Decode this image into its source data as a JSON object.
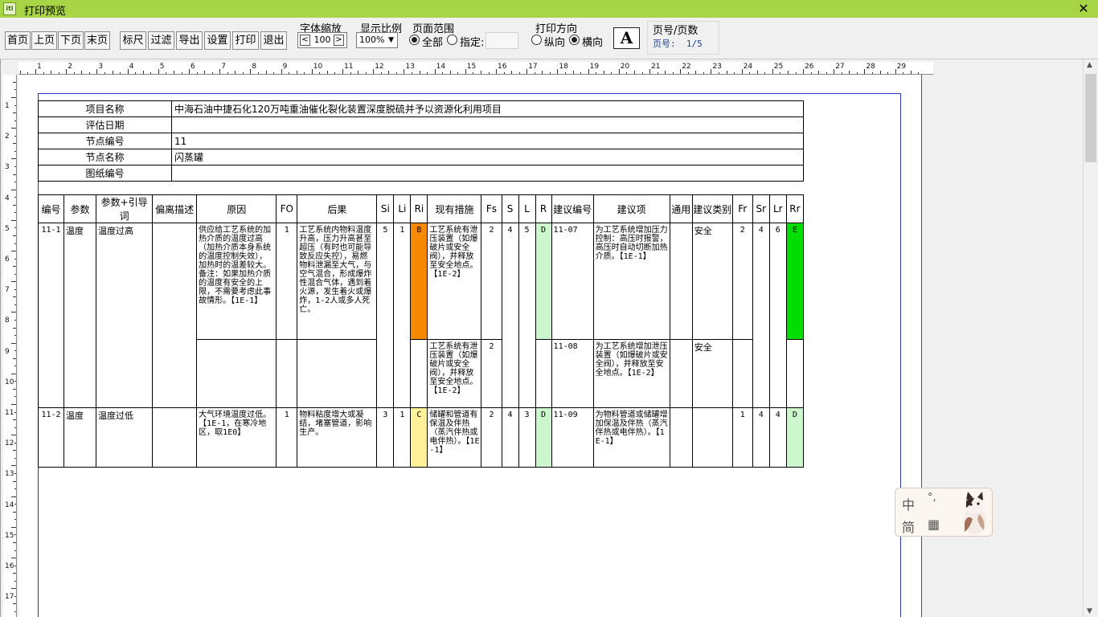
{
  "window": {
    "title": "打印预览",
    "icon_text": "iti",
    "close_label": "✕"
  },
  "toolbar": {
    "first_page": "首页",
    "prev_page": "上页",
    "next_page": "下页",
    "last_page": "末页",
    "ruler": "标尺",
    "filter": "过滤",
    "export": "导出",
    "settings": "设置",
    "print": "打印",
    "exit": "退出",
    "font_zoom_label": "字体缩放",
    "font_zoom_value": "100",
    "display_ratio_label": "显示比例",
    "display_ratio_value": "100%",
    "page_range_label": "页面范围",
    "range_all": "全部",
    "range_specify": "指定:",
    "range_selected": "all",
    "orientation_label": "打印方向",
    "portrait": "纵向",
    "landscape": "横向",
    "orientation_selected": "landscape",
    "font_button": "A",
    "page_count_label": "页号/页数",
    "page_number_text": "页号:  1/5"
  },
  "ruler": {
    "horizontal": [
      "1",
      "2",
      "3",
      "4",
      "5",
      "6",
      "7",
      "8",
      "9",
      "10",
      "11",
      "12",
      "13",
      "14",
      "15",
      "16",
      "17",
      "18",
      "19",
      "20",
      "21",
      "22",
      "23",
      "24",
      "25",
      "26",
      "27",
      "28",
      "29"
    ],
    "vertical": [
      "1",
      "2",
      "3",
      "4",
      "5",
      "6",
      "7",
      "8",
      "9",
      "10",
      "11",
      "12",
      "13",
      "14",
      "15",
      "16",
      "17"
    ]
  },
  "info": [
    {
      "label": "项目名称",
      "value": "中海石油中捷石化120万吨重油催化裂化装置深度脱硫并予以资源化利用项目"
    },
    {
      "label": "评估日期",
      "value": ""
    },
    {
      "label": "节点编号",
      "value": "11"
    },
    {
      "label": "节点名称",
      "value": "闪蒸罐"
    },
    {
      "label": "图纸编号",
      "value": ""
    }
  ],
  "hazop": {
    "headers": [
      "编号",
      "参数",
      "参数+引导词",
      "偏离描述",
      "原因",
      "FO",
      "后果",
      "Si",
      "Li",
      "Ri",
      "现有措施",
      "Fs",
      "S",
      "L",
      "R",
      "建议编号",
      "建议项",
      "通用",
      "建议类别",
      "Fr",
      "Sr",
      "Lr",
      "Rr"
    ],
    "rows": [
      {
        "id": "11-1",
        "param": "温度",
        "guide": "温度过高",
        "deviation": "",
        "cause1": "供应给工艺系统的加热介质的温度过高（加热介质本身系统的温度控制失效），加热时的温差较大。备注：如果加热介质的温度有安全的上限，不需要考虑此事故情形。【1E-1】",
        "fo1": "1",
        "consequence1": "工艺系统内物料温度升高，压力升高甚至超压（有时也可能导致反应失控），易燃物料泄漏至大气，与空气混合，形成爆炸性混合气体，遇到着火源，发生着火或爆炸，1-2人或多人死亡。",
        "si": "5",
        "li": "1",
        "ri": "B",
        "measure1": "工艺系统有泄压装置（如爆破片或安全阀），并释放至安全地点。【1E-2】",
        "fs1": "2",
        "s": "4",
        "l": "5",
        "r": "D",
        "sug_id1": "11-07",
        "suggestion1": "为工艺系统增加压力控制：高压时报警，高压时自动切断加热介质。【1E-1】",
        "general1": "",
        "category1": "安全",
        "fr": "2",
        "sr": "4",
        "lr": "6",
        "rr": "E",
        "measure2": "工艺系统有泄压装置（如爆破片或安全阀），并释放至安全地点。【1E-2】",
        "fs2": "2",
        "sug_id2": "11-08",
        "suggestion2": "为工艺系统增加泄压装置（如爆破片或安全阀），并释放至安全地点。【1E-2】",
        "general2": "",
        "category2": "安全"
      },
      {
        "id": "11-2",
        "param": "温度",
        "guide": "温度过低",
        "deviation": "",
        "cause": "大气环境温度过低。【1E-1，在寒冷地区，取1E0】",
        "fo": "1",
        "consequence": "物料粘度增大或凝结，堵塞管道，影响生产。",
        "si": "3",
        "li": "1",
        "ri": "C",
        "measure": "储罐和管道有保温及伴热（蒸汽伴热或电伴热）。【1E-1】",
        "fs": "2",
        "s": "4",
        "l": "3",
        "r": "D",
        "sug_id": "11-09",
        "suggestion": "为物料管道或储罐增加保温及伴热（蒸汽伴热或电伴热）。【1E-1】",
        "general": "",
        "category": "",
        "fr": "1",
        "sr": "4",
        "lr": "4",
        "rr": "D"
      }
    ]
  },
  "ime": {
    "lang": "中",
    "punct": "°,",
    "mode": "简",
    "keyboard_icon": "▦"
  },
  "colors": {
    "titlebar": "#a7d545",
    "risk_B": "#f58a00",
    "risk_C": "#fff09a",
    "risk_D": "#ccf7cc",
    "risk_E": "#00dd00",
    "margin_line": "#2a37b8"
  }
}
